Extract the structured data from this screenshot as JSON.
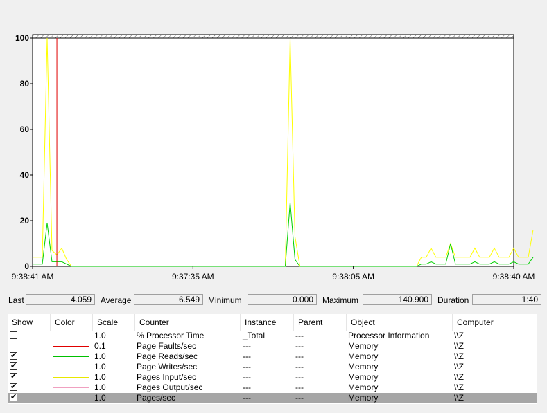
{
  "chart_data": {
    "type": "line",
    "ylim": [
      0,
      100
    ],
    "y_ticks": [
      "100",
      "80",
      "60",
      "40",
      "20",
      "0"
    ],
    "x_ticks": [
      "9:38:41 AM",
      "9:37:35 AM",
      "9:38:05 AM",
      "9:38:40 AM"
    ],
    "cursor_sample": 5,
    "sample_count": 100,
    "series": [
      {
        "name": "Pages/sec",
        "color": "#ffff00",
        "values": [
          4,
          4,
          4,
          100,
          7,
          5,
          8,
          3,
          0,
          0,
          0,
          0,
          0,
          0,
          0,
          0,
          0,
          0,
          0,
          0,
          0,
          0,
          0,
          0,
          0,
          0,
          0,
          0,
          0,
          0,
          0,
          0,
          0,
          0,
          0,
          0,
          0,
          0,
          0,
          0,
          0,
          0,
          0,
          0,
          0,
          0,
          0,
          0,
          0,
          0,
          0,
          0,
          0,
          100,
          13,
          0,
          0,
          0,
          0,
          0,
          0,
          0,
          0,
          0,
          0,
          0,
          0,
          0,
          0,
          0,
          0,
          0,
          0,
          0,
          0,
          0,
          0,
          0,
          0,
          0,
          4,
          4,
          8,
          4,
          4,
          4,
          10,
          4,
          4,
          4,
          4,
          8,
          4,
          4,
          4,
          8,
          4,
          4,
          4,
          8,
          4,
          4,
          4,
          16
        ]
      },
      {
        "name": "Page Reads/sec",
        "color": "#00d000",
        "values": [
          1,
          1,
          1,
          19,
          2,
          2,
          2,
          1,
          0,
          0,
          0,
          0,
          0,
          0,
          0,
          0,
          0,
          0,
          0,
          0,
          0,
          0,
          0,
          0,
          0,
          0,
          0,
          0,
          0,
          0,
          0,
          0,
          0,
          0,
          0,
          0,
          0,
          0,
          0,
          0,
          0,
          0,
          0,
          0,
          0,
          0,
          0,
          0,
          0,
          0,
          0,
          0,
          0,
          28,
          3,
          0,
          0,
          0,
          0,
          0,
          0,
          0,
          0,
          0,
          0,
          0,
          0,
          0,
          0,
          0,
          0,
          0,
          0,
          0,
          0,
          0,
          0,
          0,
          0,
          0,
          1,
          1,
          2,
          1,
          1,
          1,
          10,
          1,
          1,
          1,
          1,
          2,
          1,
          1,
          1,
          2,
          1,
          1,
          1,
          2,
          1,
          1,
          1,
          4
        ]
      }
    ]
  },
  "stats": {
    "last_label": "Last",
    "last_value": "4.059",
    "average_label": "Average",
    "average_value": "6.549",
    "minimum_label": "Minimum",
    "minimum_value": "0.000",
    "maximum_label": "Maximum",
    "maximum_value": "140.900",
    "duration_label": "Duration",
    "duration_value": "1:40"
  },
  "table": {
    "headers": {
      "show": "Show",
      "color": "Color",
      "scale": "Scale",
      "counter": "Counter",
      "instance": "Instance",
      "parent": "Parent",
      "object": "Object",
      "computer": "Computer"
    },
    "rows": [
      {
        "checked": false,
        "color": "#e00000",
        "scale": "1.0",
        "counter": "% Processor Time",
        "instance": "_Total",
        "parent": "---",
        "object": "Processor Information",
        "computer": "\\\\Z"
      },
      {
        "checked": false,
        "color": "#e00000",
        "scale": "0.1",
        "counter": "Page Faults/sec",
        "instance": "---",
        "parent": "---",
        "object": "Memory",
        "computer": "\\\\Z"
      },
      {
        "checked": true,
        "color": "#00c000",
        "scale": "1.0",
        "counter": "Page Reads/sec",
        "instance": "---",
        "parent": "---",
        "object": "Memory",
        "computer": "\\\\Z"
      },
      {
        "checked": true,
        "color": "#0000c0",
        "scale": "1.0",
        "counter": "Page Writes/sec",
        "instance": "---",
        "parent": "---",
        "object": "Memory",
        "computer": "\\\\Z"
      },
      {
        "checked": true,
        "color": "#e8e800",
        "scale": "1.0",
        "counter": "Pages Input/sec",
        "instance": "---",
        "parent": "---",
        "object": "Memory",
        "computer": "\\\\Z"
      },
      {
        "checked": true,
        "color": "#f0a0c0",
        "scale": "1.0",
        "counter": "Pages Output/sec",
        "instance": "---",
        "parent": "---",
        "object": "Memory",
        "computer": "\\\\Z"
      },
      {
        "checked": true,
        "color": "#20b0d0",
        "scale": "1.0",
        "counter": "Pages/sec",
        "instance": "---",
        "parent": "---",
        "object": "Memory",
        "computer": "\\\\Z",
        "selected": true
      }
    ]
  }
}
